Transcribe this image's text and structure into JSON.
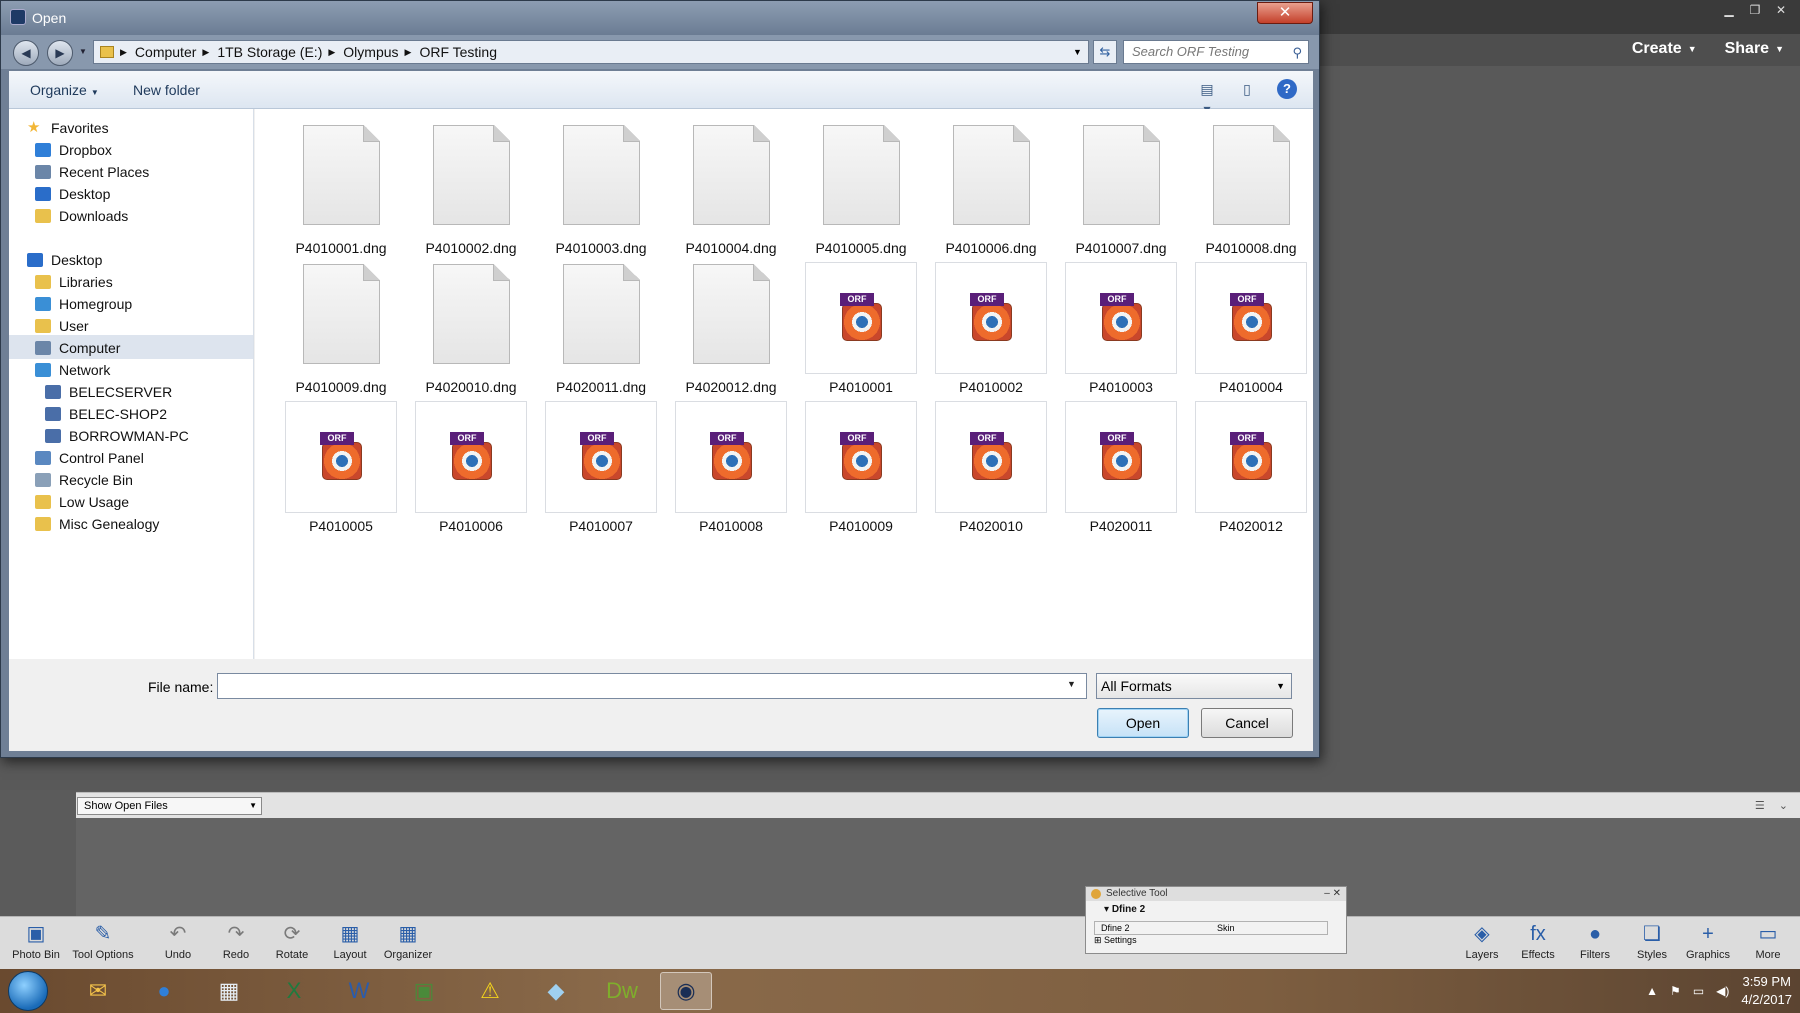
{
  "dialog": {
    "title": "Open",
    "close_label": "✕",
    "breadcrumbs": [
      "Computer",
      "1TB Storage (E:)",
      "Olympus",
      "ORF Testing"
    ],
    "search_placeholder": "Search ORF Testing",
    "organize_label": "Organize",
    "new_folder_label": "New folder",
    "help_label": "?",
    "nav_items": [
      {
        "label": "Favorites",
        "icon": "star-icon",
        "color": "#f2b636"
      },
      {
        "label": "Dropbox",
        "icon": "dropbox-icon",
        "color": "#2f7fd8"
      },
      {
        "label": "Recent Places",
        "icon": "recent-places-icon",
        "color": "#6b86a8"
      },
      {
        "label": "Desktop",
        "icon": "desktop-icon",
        "color": "#2a6dc9"
      },
      {
        "label": "Downloads",
        "icon": "downloads-icon",
        "color": "#e9c14c"
      },
      {
        "label": "Desktop",
        "icon": "desktop-icon",
        "color": "#2a6dc9"
      },
      {
        "label": "Libraries",
        "icon": "libraries-icon",
        "color": "#e9c14c"
      },
      {
        "label": "Homegroup",
        "icon": "homegroup-icon",
        "color": "#3a8fd6"
      },
      {
        "label": "User",
        "icon": "user-folder-icon",
        "color": "#e9c14c"
      },
      {
        "label": "Computer",
        "icon": "computer-icon",
        "color": "#6b86a8"
      },
      {
        "label": "Network",
        "icon": "network-icon",
        "color": "#3a8fd6"
      },
      {
        "label": "BELECSERVER",
        "icon": "network-pc-icon",
        "color": "#4a6ea8"
      },
      {
        "label": "BELEC-SHOP2",
        "icon": "network-pc-icon",
        "color": "#4a6ea8"
      },
      {
        "label": "BORROWMAN-PC",
        "icon": "network-pc-icon",
        "color": "#4a6ea8"
      },
      {
        "label": "Control Panel",
        "icon": "control-panel-icon",
        "color": "#5a88c0"
      },
      {
        "label": "Recycle Bin",
        "icon": "recycle-bin-icon",
        "color": "#8aa0b8"
      },
      {
        "label": "Low Usage",
        "icon": "folder-icon",
        "color": "#e9c14c"
      },
      {
        "label": "Misc Genealogy",
        "icon": "folder-icon",
        "color": "#e9c14c"
      }
    ],
    "files": [
      {
        "name": "P4010001.dng",
        "type": "dng"
      },
      {
        "name": "P4010002.dng",
        "type": "dng"
      },
      {
        "name": "P4010003.dng",
        "type": "dng"
      },
      {
        "name": "P4010004.dng",
        "type": "dng"
      },
      {
        "name": "P4010005.dng",
        "type": "dng"
      },
      {
        "name": "P4010006.dng",
        "type": "dng"
      },
      {
        "name": "P4010007.dng",
        "type": "dng"
      },
      {
        "name": "P4010008.dng",
        "type": "dng"
      },
      {
        "name": "P4010009.dng",
        "type": "dng"
      },
      {
        "name": "P4020010.dng",
        "type": "dng"
      },
      {
        "name": "P4020011.dng",
        "type": "dng"
      },
      {
        "name": "P4020012.dng",
        "type": "dng"
      },
      {
        "name": "P4010001",
        "type": "orf"
      },
      {
        "name": "P4010002",
        "type": "orf"
      },
      {
        "name": "P4010003",
        "type": "orf"
      },
      {
        "name": "P4010004",
        "type": "orf"
      },
      {
        "name": "P4010005",
        "type": "orf"
      },
      {
        "name": "P4010006",
        "type": "orf"
      },
      {
        "name": "P4010007",
        "type": "orf"
      },
      {
        "name": "P4010008",
        "type": "orf"
      },
      {
        "name": "P4010009",
        "type": "orf"
      },
      {
        "name": "P4020010",
        "type": "orf"
      },
      {
        "name": "P4020011",
        "type": "orf"
      },
      {
        "name": "P4020012",
        "type": "orf"
      }
    ],
    "orf_badge": "ORF",
    "filename_label": "File name:",
    "filename_value": "",
    "format_selected": "All Formats",
    "open_label": "Open",
    "cancel_label": "Cancel"
  },
  "app": {
    "create_label": "Create",
    "share_label": "Share",
    "bin_dropdown": "Show Open Files",
    "toolbar_left": [
      {
        "label": "Photo Bin",
        "icon": "photo-bin-icon"
      },
      {
        "label": "Tool Options",
        "icon": "tool-options-icon"
      },
      {
        "label": "Undo",
        "icon": "undo-icon"
      },
      {
        "label": "Redo",
        "icon": "redo-icon"
      },
      {
        "label": "Rotate",
        "icon": "rotate-icon"
      },
      {
        "label": "Layout",
        "icon": "layout-icon"
      },
      {
        "label": "Organizer",
        "icon": "organizer-icon"
      }
    ],
    "toolbar_right": [
      {
        "label": "Layers",
        "icon": "layers-icon"
      },
      {
        "label": "Effects",
        "icon": "effects-icon"
      },
      {
        "label": "Filters",
        "icon": "filters-icon"
      },
      {
        "label": "Styles",
        "icon": "styles-icon"
      },
      {
        "label": "Graphics",
        "icon": "graphics-icon"
      },
      {
        "label": "More",
        "icon": "more-icon"
      }
    ],
    "selective_tool": {
      "title": "Selective Tool",
      "plugin": "Dfine 2",
      "tab_left": "Dfine 2",
      "tab_right": "Skin",
      "settings": "Settings"
    }
  },
  "taskbar": {
    "time": "3:59 PM",
    "date": "4/2/2017",
    "apps": [
      {
        "name": "outlook-icon",
        "glyph": "✉"
      },
      {
        "name": "firefox-icon",
        "glyph": "●"
      },
      {
        "name": "calculator-icon",
        "glyph": "▦"
      },
      {
        "name": "excel-icon",
        "glyph": "X"
      },
      {
        "name": "word-icon",
        "glyph": "W"
      },
      {
        "name": "image-app-icon",
        "glyph": "▣"
      },
      {
        "name": "warning-icon",
        "glyph": "⚠"
      },
      {
        "name": "blue-app-icon",
        "glyph": "◆"
      },
      {
        "name": "dreamweaver-icon",
        "glyph": "Dw"
      },
      {
        "name": "photoshop-elements-icon",
        "glyph": "◉"
      }
    ]
  }
}
